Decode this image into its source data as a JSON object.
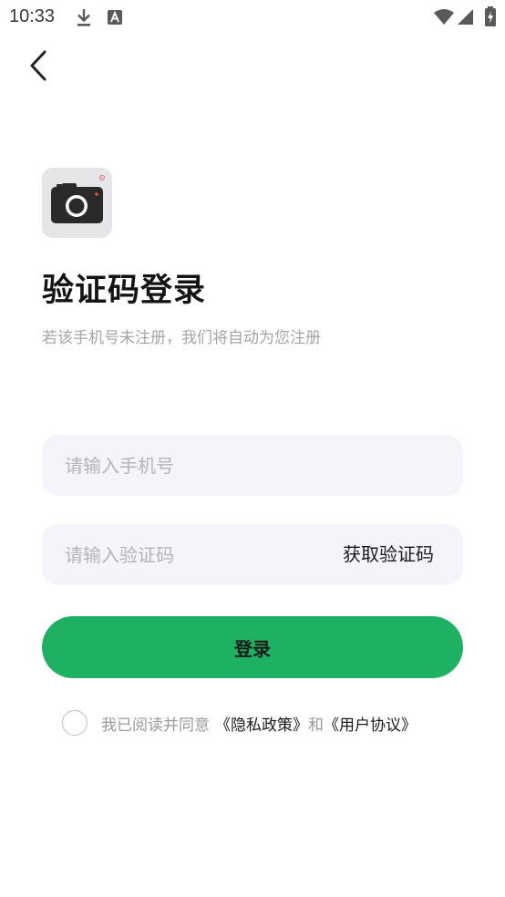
{
  "status_bar": {
    "time": "10:33",
    "icons": [
      "download-icon",
      "text-recognition-icon",
      "wifi-icon",
      "signal-icon",
      "battery-charging-icon"
    ]
  },
  "navigation": {
    "back_icon": "chevron-left-icon"
  },
  "app": {
    "icon": "camera-icon"
  },
  "login": {
    "title": "验证码登录",
    "subtitle": "若该手机号未注册，我们将自动为您注册",
    "phone_placeholder": "请输入手机号",
    "phone_value": "",
    "code_placeholder": "请输入验证码",
    "code_value": "",
    "get_code_label": "获取验证码",
    "submit_label": "登录"
  },
  "agreement": {
    "checked": false,
    "prefix": "我已阅读并同意",
    "privacy_link": "《隐私政策》",
    "conjunction": "和",
    "terms_link": "《用户协议》"
  },
  "colors": {
    "primary": "#1fb163",
    "input_background": "#f4f4fa",
    "placeholder": "#b4b4b8",
    "secondary_text": "#a5a5a5"
  }
}
